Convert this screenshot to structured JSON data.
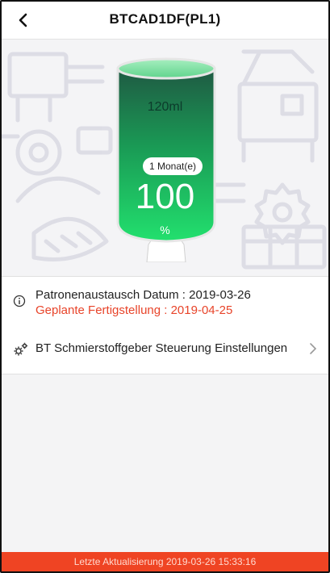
{
  "header": {
    "title": "BTCAD1DF(PL1)",
    "back_icon": "chevron-left-icon"
  },
  "cartridge": {
    "volume": "120ml",
    "period": "1 Monat(e)",
    "percent_value": "100",
    "percent_sign": "%",
    "fill_level": 1.0,
    "colors": {
      "top": "#2a6e4f",
      "bottom": "#1fd86a",
      "cap": "#86e1a6"
    }
  },
  "info": {
    "icon": "info-icon",
    "replacement_date": "Patronenaustausch Datum : 2019-03-26",
    "planned_completion": "Geplante Fertigstellung : 2019-04-25",
    "planned_color": "#e8442a"
  },
  "settings": {
    "icon": "gear-icon",
    "label": "BT Schmierstoffgeber Steuerung Einstellungen",
    "chevron_icon": "chevron-right-icon"
  },
  "footer": {
    "last_update": "Letzte Aktualisierung 2019-03-26 15:33:16",
    "color": "#ef4423"
  }
}
